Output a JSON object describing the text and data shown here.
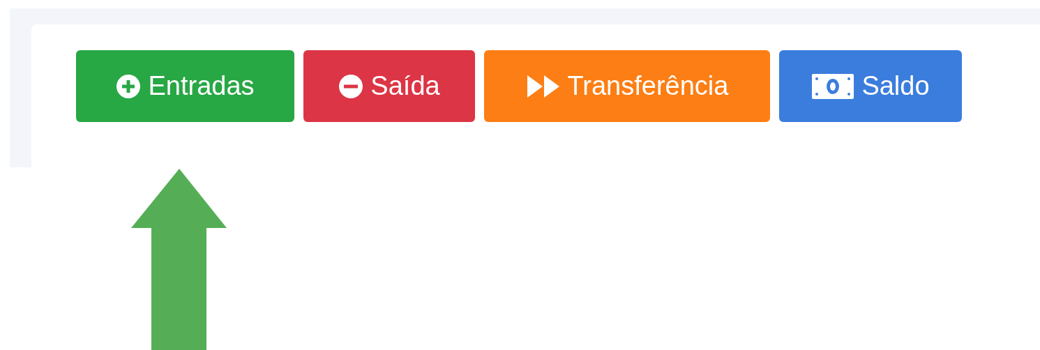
{
  "buttons": [
    {
      "label": "Entradas",
      "kind": "plus",
      "color": "#28a745"
    },
    {
      "label": "Saída",
      "kind": "minus",
      "color": "#dc3545"
    },
    {
      "label": "Transferência",
      "kind": "forward",
      "color": "#fd7e14"
    },
    {
      "label": "Saldo",
      "kind": "money",
      "color": "#3b7ddd"
    }
  ]
}
